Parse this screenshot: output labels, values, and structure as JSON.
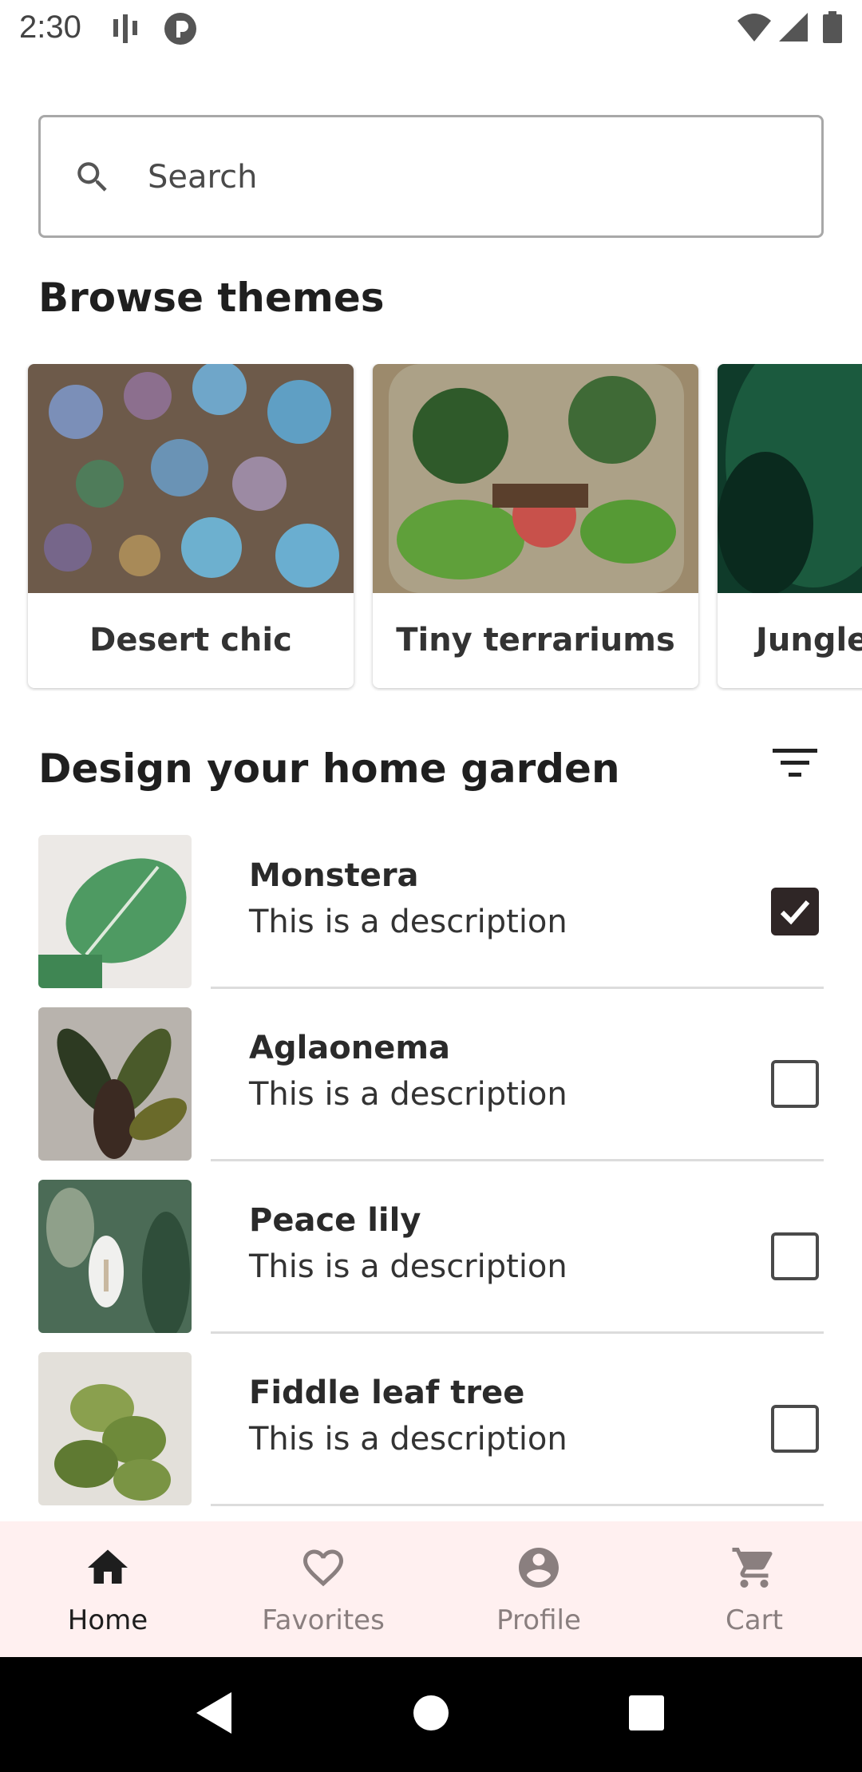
{
  "status_bar": {
    "time": "2:30"
  },
  "search": {
    "placeholder": "Search"
  },
  "browse": {
    "title": "Browse themes",
    "themes": [
      {
        "label": "Desert chic"
      },
      {
        "label": "Tiny terrariums"
      },
      {
        "label": "Jungle vibes"
      }
    ]
  },
  "garden": {
    "title": "Design your home garden",
    "plants": [
      {
        "name": "Monstera",
        "description": "This is a description",
        "checked": true
      },
      {
        "name": "Aglaonema",
        "description": "This is a description",
        "checked": false
      },
      {
        "name": "Peace lily",
        "description": "This is a description",
        "checked": false
      },
      {
        "name": "Fiddle leaf tree",
        "description": "This is a description",
        "checked": false
      }
    ]
  },
  "bottom_nav": {
    "items": [
      {
        "label": "Home",
        "icon": "home-icon",
        "active": true
      },
      {
        "label": "Favorites",
        "icon": "heart-icon",
        "active": false
      },
      {
        "label": "Profile",
        "icon": "account-circle-icon",
        "active": false
      },
      {
        "label": "Cart",
        "icon": "cart-icon",
        "active": false
      }
    ]
  },
  "colors": {
    "accent": "#2f2626",
    "nav_background": "#fff0f0",
    "inactive_nav": "#8a7f7f"
  }
}
